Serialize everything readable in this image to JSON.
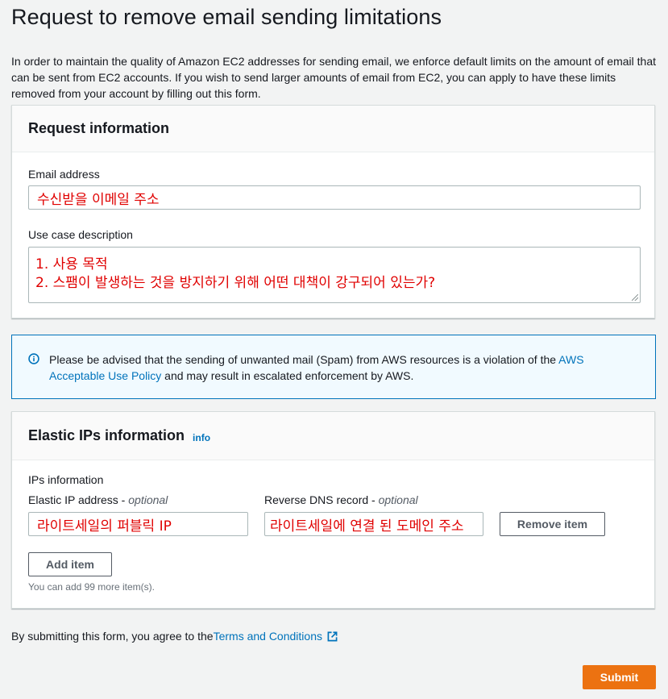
{
  "page": {
    "title": "Request to remove email sending limitations",
    "intro": "In order to maintain the quality of Amazon EC2 addresses for sending email, we enforce default limits on the amount of email that can be sent from EC2 accounts. If you wish to send larger amounts of email from EC2, you can apply to have these limits removed from your account by filling out this form."
  },
  "request_info": {
    "heading": "Request information",
    "email_label": "Email address",
    "email_value": "수신받을 이메일 주소",
    "use_case_label": "Use case description",
    "use_case_line1": "1. 사용 목적",
    "use_case_line2": "2. 스팸이 발생하는 것을 방지하기 위해 어떤 대책이 강구되어 있는가?"
  },
  "alert": {
    "text_before": "Please be advised that the sending of unwanted mail (Spam) from AWS resources is a violation of the ",
    "link": "AWS Acceptable Use Policy",
    "text_after": " and may result in escalated enforcement by AWS."
  },
  "elastic_ips": {
    "heading": "Elastic IPs information",
    "info_link": "info",
    "section_label": "IPs information",
    "ip_label": "Elastic IP address",
    "ip_optional": "optional",
    "dns_label": "Reverse DNS record",
    "dns_optional": "optional",
    "ip_value": "라이트세일의 퍼블릭 IP",
    "dns_value": "라이트세일에 연결 된 도메인 주소",
    "remove_button": "Remove item",
    "add_button": "Add item",
    "hint": "You can add 99 more item(s)."
  },
  "footer": {
    "terms_before": "By submitting this form, you agree to the ",
    "terms_link": "Terms and Conditions",
    "submit": "Submit"
  },
  "colors": {
    "accent": "#0073bb",
    "submit": "#ec7211",
    "annotation_text": "#e00000"
  }
}
